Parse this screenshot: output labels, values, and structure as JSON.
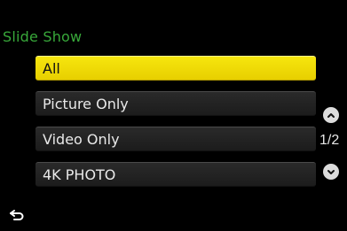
{
  "screen": {
    "title": "Slide Show",
    "title_color": "#38a83a"
  },
  "menu": {
    "items": [
      {
        "label": "All",
        "selected": true
      },
      {
        "label": "Picture Only",
        "selected": false
      },
      {
        "label": "Video Only",
        "selected": false
      },
      {
        "label": "4K PHOTO",
        "selected": false
      }
    ],
    "selected_color": "#f2dd05"
  },
  "pagination": {
    "page_indicator": "1/2",
    "up_icon": "chevron-up-icon",
    "down_icon": "chevron-down-icon"
  },
  "footer": {
    "back_icon": "return-arrow-icon"
  }
}
